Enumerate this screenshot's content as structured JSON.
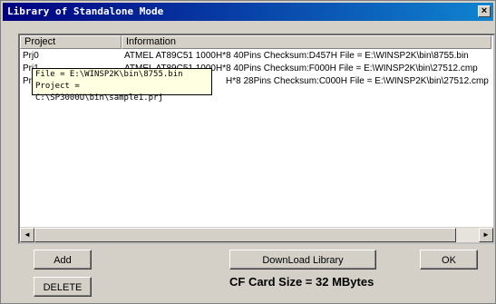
{
  "window": {
    "title": "Library of Standalone Mode",
    "close_glyph": "×"
  },
  "table": {
    "columns": [
      "Project",
      "Information"
    ],
    "rows": [
      {
        "project": "Prj0",
        "info": "ATMEL  AT89C51  1000H*8  40Pins  Checksum:D457H  File = E:\\WINSP2K\\bin\\8755.bin"
      },
      {
        "project": "Prj1",
        "info": "ATMEL  AT89C51  1000H*8  40Pins  Checksum:F000H  File = E:\\WINSP2K\\bin\\27512.cmp"
      },
      {
        "project": "Prj",
        "info": "H*8  28Pins  Checksum:C000H  File = E:\\WINSP2K\\bin\\27512.cmp"
      }
    ]
  },
  "tooltip": {
    "line1": "File = E:\\WINSP2K\\bin\\8755.bin",
    "line2": "Project = C:\\SP3000U\\bin\\sample1.prj"
  },
  "scrollbar": {
    "left_arrow": "◄",
    "right_arrow": "►"
  },
  "buttons": {
    "add": "Add",
    "delete": "DELETE",
    "download": "DownLoad Library",
    "ok": "OK"
  },
  "status": {
    "cf_card": "CF Card Size = 32 MBytes"
  }
}
